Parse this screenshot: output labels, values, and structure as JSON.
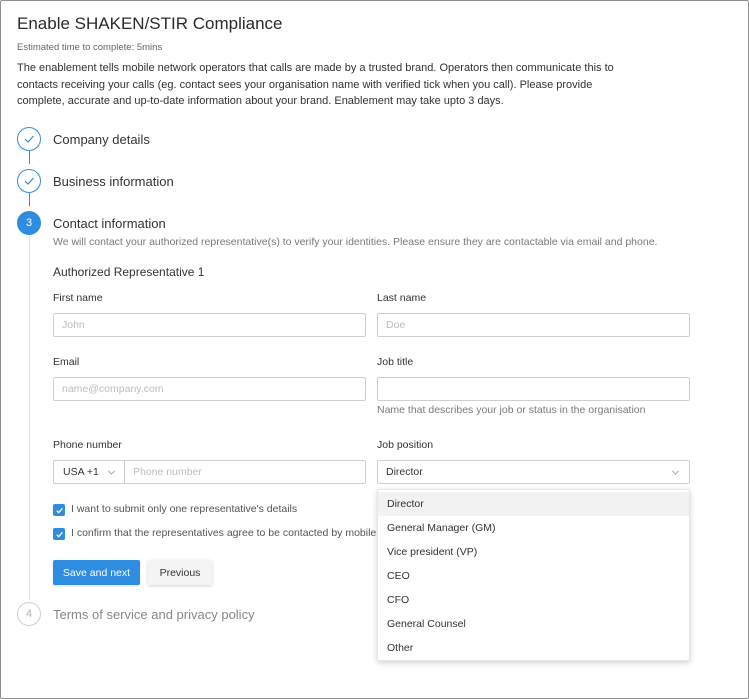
{
  "header": {
    "title": "Enable SHAKEN/STIR Compliance",
    "estimate": "Estimated time to complete: 5mins",
    "description": "The enablement tells mobile network operators that calls are made by a trusted brand. Operators then communicate this to contacts receiving your calls (eg. contact sees your organisation name with verified tick when you call). Please provide complete, accurate and up-to-date information about your brand. Enablement may take upto 3 days."
  },
  "steps": [
    {
      "label": "Company details",
      "status": "done"
    },
    {
      "label": "Business information",
      "status": "done"
    },
    {
      "label": "Contact information",
      "status": "active",
      "number": "3"
    },
    {
      "label": "Terms of service and privacy policy",
      "status": "pending",
      "number": "4"
    }
  ],
  "contact": {
    "subtitle": "We will contact your authorized representative(s) to verify your identities. Please ensure they are contactable via email and phone.",
    "rep_heading": "Authorized Representative 1",
    "first_name": {
      "label": "First name",
      "placeholder": "John",
      "value": ""
    },
    "last_name": {
      "label": "Last name",
      "placeholder": "Doe",
      "value": ""
    },
    "email": {
      "label": "Email",
      "placeholder": "name@company.com",
      "value": ""
    },
    "job_title": {
      "label": "Job title",
      "value": "",
      "hint": "Name that describes your job or status in the organisation"
    },
    "phone": {
      "label": "Phone number",
      "country_code": "USA +1",
      "placeholder": "Phone number",
      "value": ""
    },
    "job_position": {
      "label": "Job position",
      "value": "Director"
    },
    "checkbox_single": {
      "label": "I want to submit only one representative's details",
      "checked": true
    },
    "checkbox_confirm": {
      "label": "I confirm that the representatives agree to be contacted by mobile network operators",
      "checked": true
    },
    "save_label": "Save and next",
    "previous_label": "Previous"
  },
  "dropdown": {
    "options": [
      "Director",
      "General Manager (GM)",
      "Vice president (VP)",
      "CEO",
      "CFO",
      "General Counsel",
      "Other"
    ],
    "selected": "Director"
  },
  "colors": {
    "accent": "#2e8ddf",
    "border": "#cfcfcf"
  }
}
